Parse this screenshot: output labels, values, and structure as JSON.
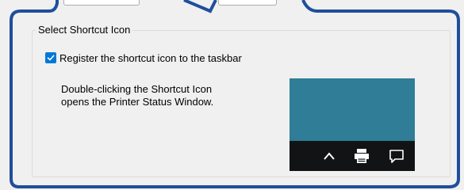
{
  "groupbox": {
    "title": "Select Shortcut Icon"
  },
  "checkbox": {
    "label": "Register the shortcut icon to the taskbar",
    "checked": true
  },
  "description": {
    "line1": "Double-clicking the Shortcut Icon",
    "line2": "opens the Printer Status Window."
  },
  "preview": {
    "desktop_color": "#2f7d96",
    "taskbar_color": "#111314",
    "tray_icons": [
      "chevron-up-icon",
      "printer-icon",
      "action-center-icon"
    ]
  },
  "colors": {
    "callout_border": "#1f4e9c",
    "checkbox_accent": "#0078d7"
  }
}
